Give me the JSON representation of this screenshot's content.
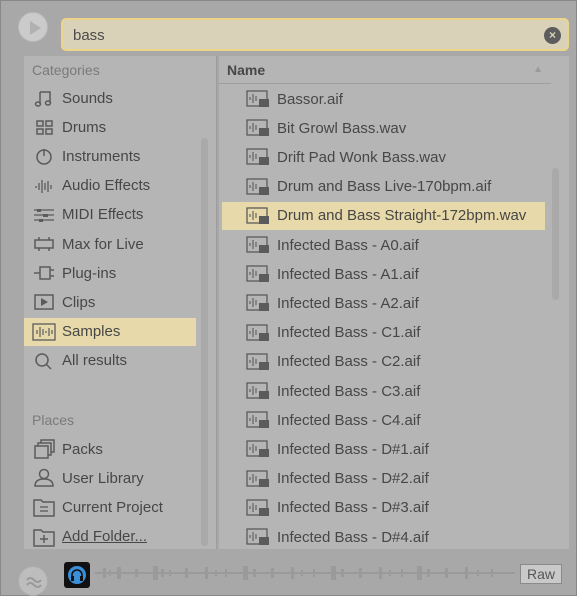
{
  "search": {
    "value": "bass"
  },
  "sidebar": {
    "categories_header": "Categories",
    "places_header": "Places",
    "categories": [
      {
        "label": "Sounds",
        "icon": "note-icon"
      },
      {
        "label": "Drums",
        "icon": "drum-grid-icon"
      },
      {
        "label": "Instruments",
        "icon": "power-icon"
      },
      {
        "label": "Audio Effects",
        "icon": "audio-effects-icon"
      },
      {
        "label": "MIDI Effects",
        "icon": "midi-effects-icon"
      },
      {
        "label": "Max for Live",
        "icon": "max-icon"
      },
      {
        "label": "Plug-ins",
        "icon": "plugin-icon"
      },
      {
        "label": "Clips",
        "icon": "clip-icon"
      },
      {
        "label": "Samples",
        "icon": "sample-icon",
        "selected": true
      },
      {
        "label": "All results",
        "icon": "search-icon"
      }
    ],
    "places": [
      {
        "label": "Packs",
        "icon": "packs-icon"
      },
      {
        "label": "User Library",
        "icon": "user-icon"
      },
      {
        "label": "Current Project",
        "icon": "project-folder-icon"
      },
      {
        "label": "Add Folder...",
        "icon": "add-folder-icon"
      }
    ]
  },
  "list": {
    "column_header": "Name",
    "files": [
      "Bassor.aif",
      "Bit Growl Bass.wav",
      "Drift Pad Wonk Bass.wav",
      "Drum and Bass Live-170bpm.aif",
      "Drum and Bass Straight-172bpm.wav",
      "Infected Bass - A0.aif",
      "Infected Bass - A1.aif",
      "Infected Bass - A2.aif",
      "Infected Bass - C1.aif",
      "Infected Bass - C2.aif",
      "Infected Bass - C3.aif",
      "Infected Bass - C4.aif",
      "Infected Bass - D#1.aif",
      "Infected Bass - D#2.aif",
      "Infected Bass - D#3.aif",
      "Infected Bass - D#4.aif"
    ],
    "selected_index": 4
  },
  "bottom": {
    "raw_label": "Raw"
  },
  "colors": {
    "selection": "#e7d9a9",
    "search_border": "#ecd58a",
    "preview": "#3a8fd9"
  }
}
